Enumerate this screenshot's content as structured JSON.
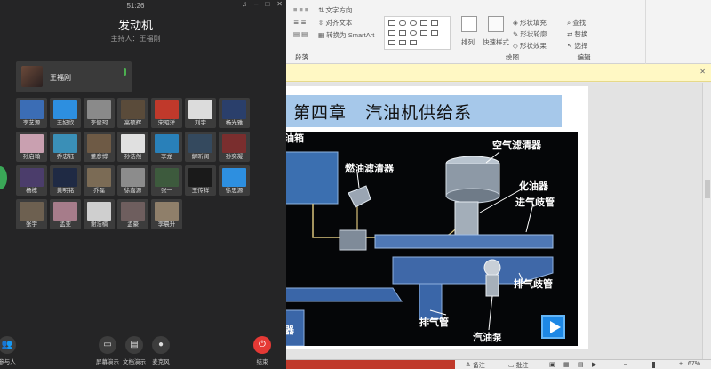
{
  "meeting": {
    "time": "51:26",
    "title": "发动机",
    "host_line": "主持人：王福刚",
    "host_name": "王福刚",
    "participants": [
      {
        "name": "李艺源",
        "color": "#3b6db5"
      },
      {
        "name": "王妃欣",
        "color": "#2d8fe0"
      },
      {
        "name": "李健珂",
        "color": "#8a8a8a"
      },
      {
        "name": "高硕辉",
        "color": "#5a4b3a"
      },
      {
        "name": "宋昭洋",
        "color": "#c0392b"
      },
      {
        "name": "刘宇",
        "color": "#dcdcdc"
      },
      {
        "name": "杨光雅",
        "color": "#2a3f6b"
      },
      {
        "name": "孙启翰",
        "color": "#c9a0b0"
      },
      {
        "name": "乔忠钰",
        "color": "#3a8fb7"
      },
      {
        "name": "董彦博",
        "color": "#6e5a45"
      },
      {
        "name": "孙浩然",
        "color": "#e0e0e0"
      },
      {
        "name": "李龙",
        "color": "#2980b9"
      },
      {
        "name": "解昕润",
        "color": "#34495e"
      },
      {
        "name": "孙奕凝",
        "color": "#7a2e2e"
      },
      {
        "name": "杨栋",
        "color": "#4b3d6b"
      },
      {
        "name": "黄明铭",
        "color": "#1f2a44"
      },
      {
        "name": "乔磊",
        "color": "#7b6b55"
      },
      {
        "name": "徐嘉源",
        "color": "#8c8c8c"
      },
      {
        "name": "张一",
        "color": "#3d5a3d"
      },
      {
        "name": "王传祥",
        "color": "#1a1a1a"
      },
      {
        "name": "徐思源",
        "color": "#2d8fe0"
      },
      {
        "name": "张宇",
        "color": "#6d6050"
      },
      {
        "name": "孟亚",
        "color": "#a67c8a"
      },
      {
        "name": "谢浩楠",
        "color": "#cfcfcf"
      },
      {
        "name": "孟豪",
        "color": "#6e5e5e"
      },
      {
        "name": "李晨升",
        "color": "#8f7f6a"
      }
    ],
    "bottom": {
      "participants": "参与人",
      "screen_share": "屏幕演示",
      "doc_share": "文档演示",
      "mic": "麦克风",
      "end": "结束"
    }
  },
  "ppt": {
    "ribbon": {
      "text_direction": "文字方向",
      "align_text": "对齐文本",
      "smartart": "转换为 SmartArt",
      "paragraph": "段落",
      "arrange": "排列",
      "quick_styles": "快速样式",
      "shape_fill": "形状填充",
      "shape_outline": "形状轮廓",
      "shape_effects": "形状效果",
      "drawing": "绘图",
      "find": "查找",
      "replace": "替换",
      "select": "选择",
      "editing": "编辑"
    },
    "slide": {
      "title": "第四章   汽油机供给系",
      "labels": {
        "fuel_tank": "油箱",
        "air_filter": "空气滤清器",
        "fuel_filter": "燃油滤清器",
        "carburetor": "化油器",
        "intake_manifold": "进气歧管",
        "exhaust_manifold": "排气歧管",
        "exhaust_pipe": "排气管",
        "fuel_pump": "汽油泵",
        "muffler": "器"
      }
    },
    "status": {
      "notes": "备注",
      "comments": "批注",
      "zoom": "67%"
    }
  }
}
